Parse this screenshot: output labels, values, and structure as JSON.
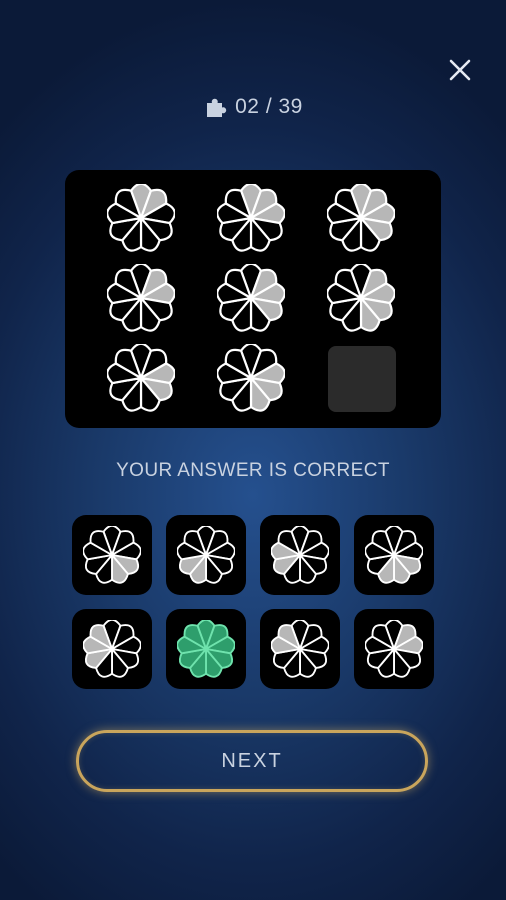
{
  "header": {
    "counter": "02 / 39",
    "puzzle_icon": "puzzle-icon",
    "close_icon": "close-icon"
  },
  "board": {
    "rows": 3,
    "cols": 3,
    "cells": [
      {
        "filled": [
          0,
          1
        ]
      },
      {
        "filled": [
          0,
          1,
          2
        ]
      },
      {
        "filled": [
          0,
          1,
          2,
          3
        ]
      },
      {
        "filled": [
          1,
          2
        ]
      },
      {
        "filled": [
          1,
          2,
          3
        ]
      },
      {
        "filled": [
          1,
          2,
          3,
          4
        ]
      },
      {
        "filled": [
          2,
          3
        ]
      },
      {
        "filled": [
          2,
          3,
          4
        ]
      },
      null
    ]
  },
  "status": "YOUR ANSWER IS CORRECT",
  "options": [
    {
      "filled": [
        3,
        4
      ]
    },
    {
      "filled": [
        5,
        6
      ]
    },
    {
      "filled": [
        6,
        7
      ]
    },
    {
      "filled": [
        3,
        4,
        5
      ]
    },
    {
      "filled": [
        6,
        7,
        8
      ]
    },
    {
      "filled": [
        2,
        3,
        4,
        5
      ],
      "selected": true
    },
    {
      "filled": [
        7,
        8
      ]
    },
    {
      "filled": [
        1,
        2
      ]
    }
  ],
  "next_label": "NEXT",
  "colors": {
    "petal_fill": "#b7b7b7",
    "petal_stroke": "#ffffff",
    "correct_fill": "#2e9e6c",
    "correct_stroke": "#6fe3ad",
    "button_border": "#c9a55c"
  }
}
